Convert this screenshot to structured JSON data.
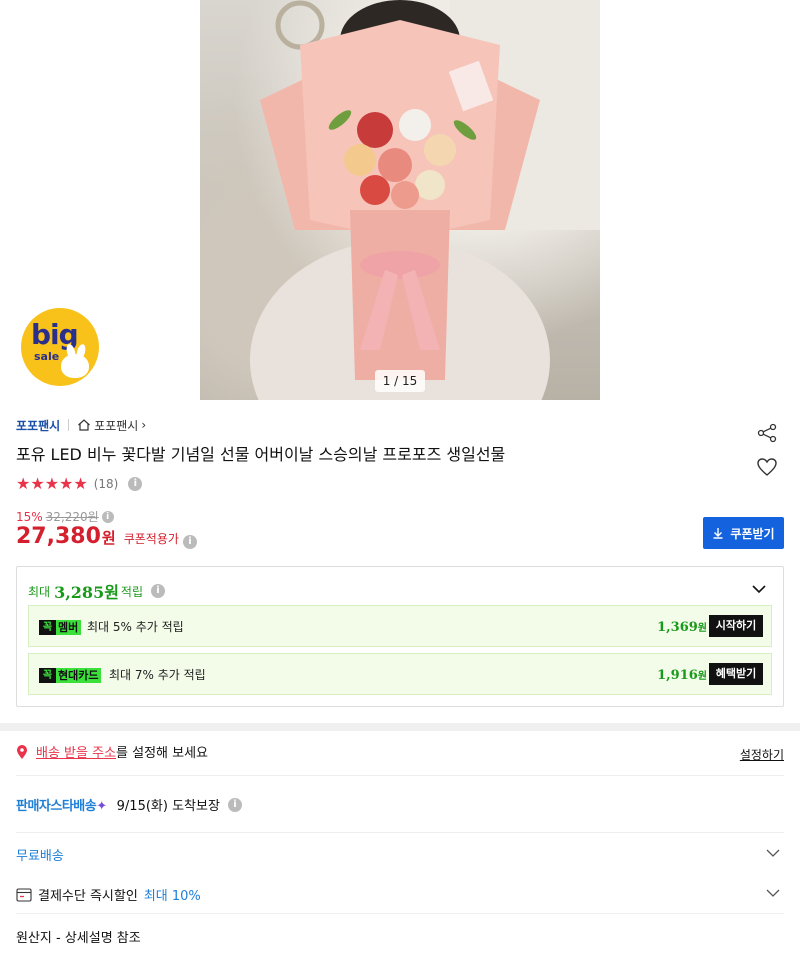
{
  "hero": {
    "image_alt": "pink bouquet photo",
    "counter": "1 / 15"
  },
  "badge": {
    "big": "big",
    "sale": "sale"
  },
  "seller": {
    "brand": "포포팬시",
    "store": "포포팬시",
    "store_chevron": "›"
  },
  "product": {
    "title": "포유 LED 비누 꽃다발 기념일 선물 어버이날 스승의날 프로포즈 생일선물",
    "stars": "★★★★★",
    "review_count": "(18)",
    "discount_rate": "15%",
    "original_price": "32,220원",
    "price": "27,380",
    "price_unit": "원",
    "coupon_applied": "쿠폰적용가",
    "coupon_button": "쿠폰받기"
  },
  "rewards": {
    "prefix": "최대",
    "amount": "3,285원",
    "suffix": "적립",
    "items": [
      {
        "tag_k": "꼭",
        "tag": "멤버",
        "desc": "최대 5% 추가 적립",
        "amount": "1,369",
        "unit": "원",
        "button": "시작하기"
      },
      {
        "tag_k": "꼭",
        "tag": "현대카드",
        "desc": "최대 7% 추가 적립",
        "amount": "1,916",
        "unit": "원",
        "button": "혜택받기"
      }
    ]
  },
  "address": {
    "link": "배송 받을 주소",
    "rest": "를 설정해 보세요",
    "set": "설정하기"
  },
  "delivery": {
    "logo": "판매자스타배송",
    "spark": "✦",
    "date": "9/15(화) 도착보장",
    "free": "무료배송",
    "pay_label": "결제수단 즉시할인",
    "pay_max": "최대 10%",
    "origin": "원산지 - 상세설명 참조"
  },
  "colors": {
    "accent_red": "#d4202e",
    "star_red": "#e8334a",
    "blue": "#1462de",
    "green": "#1a9a1a",
    "tag_green": "#3be03b"
  }
}
